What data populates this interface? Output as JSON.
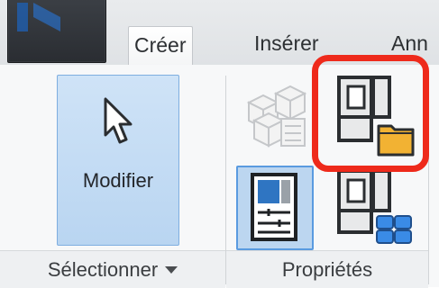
{
  "tabs": [
    "Créer",
    "Insérer",
    "Ann"
  ],
  "panels": {
    "select": {
      "button_label": "Modifier",
      "title": "Sélectionner"
    },
    "properties": {
      "title": "Propriétés"
    }
  },
  "icons": {
    "pointer": "cursor-arrow-icon",
    "type_properties": "type-properties-icon",
    "family_category": "family-category-icon",
    "properties_palette": "properties-palette-icon",
    "project_browser": "project-browser-icon"
  },
  "colors": {
    "selection_blue": "#bcd6f0",
    "highlight_red": "#ee2a1b",
    "folder_yellow": "#f2b233"
  }
}
